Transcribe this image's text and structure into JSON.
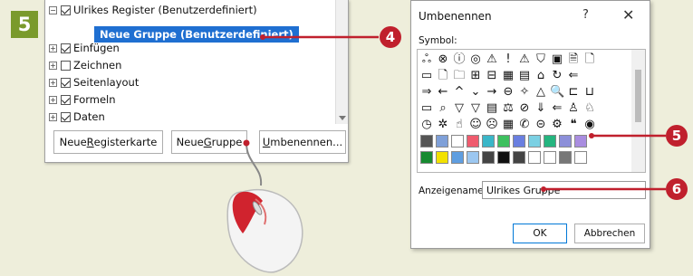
{
  "step": {
    "number": "5"
  },
  "ribbon": {
    "tree": [
      {
        "label": "Ulrikes Register (Benutzerdefiniert)",
        "expander": "⊟",
        "checked": true
      },
      {
        "label": "Neue Gruppe (Benutzerdefiniert)",
        "selected": true
      },
      {
        "label": "Einfügen",
        "expander": "⊞",
        "checked": true
      },
      {
        "label": "Zeichnen",
        "expander": "⊞",
        "checked": false
      },
      {
        "label": "Seitenlayout",
        "expander": "⊞",
        "checked": true
      },
      {
        "label": "Formeln",
        "expander": "⊞",
        "checked": true
      },
      {
        "label": "Daten",
        "expander": "⊞",
        "checked": true
      }
    ],
    "buttons": {
      "new_tab": {
        "pre": "Neue ",
        "ul": "R",
        "post": "egisterkarte"
      },
      "new_group": {
        "pre": "Neue ",
        "ul": "G",
        "post": "ruppe"
      },
      "rename": {
        "pre": "",
        "ul": "U",
        "post": "mbenennen..."
      }
    }
  },
  "dialog": {
    "title": "Umbenennen",
    "help": "?",
    "close": "✕",
    "symbol_label": "Symbol:",
    "symbols": [
      [
        "ஃ",
        "⊗",
        "ⓘ",
        "◎",
        "⚠",
        "!",
        "⚠",
        "⛉",
        "▣",
        "🗎",
        "🗋"
      ],
      [
        "▭",
        "🗋",
        "🗀",
        "⊞",
        "⊟",
        "▦",
        "▤",
        "⌂",
        "↻",
        "⇐"
      ],
      [
        "⇒",
        "←",
        "^",
        "⌄",
        "→",
        "⊖",
        "✧",
        "△",
        "🔍",
        "⊏",
        "⊔"
      ],
      [
        "▭",
        "⌕",
        "▽",
        "▽",
        "▤",
        "⚖",
        "⊘",
        "⇓",
        "⇐",
        "♙",
        "♘"
      ],
      [
        "◷",
        "✲",
        "☝",
        "☺",
        "☹",
        "▦",
        "✆",
        "⊝",
        "⚙",
        "❝",
        "◉"
      ]
    ],
    "swatch_rows": [
      [
        "#555555",
        "#7fa0d8",
        "#ffffff",
        "#ef5b6e",
        "#3ab6c8",
        "#3ec05f",
        "#6a7fe0",
        "#7bd0e3",
        "#25b57f",
        "#8c8fd9",
        "#a98de0"
      ],
      [
        "#178a30",
        "#f2e100",
        "#5f9ee0",
        "#9cc7f0",
        "#444444",
        "#111111",
        "#444444",
        "#ffffff",
        "#ffffff",
        "#777777",
        "#ffffff"
      ]
    ],
    "name_label": "Anzeigename:",
    "name_value": "Ulrikes Gruppe",
    "ok_label": "OK",
    "cancel_label": "Abbrechen"
  },
  "callouts": {
    "c4": "4",
    "c5": "5",
    "c6": "6"
  },
  "colors": {
    "accent": "#c0202d",
    "selection": "#1f6fd1",
    "step_badge": "#7a9a2c",
    "background": "#eeeedb"
  }
}
